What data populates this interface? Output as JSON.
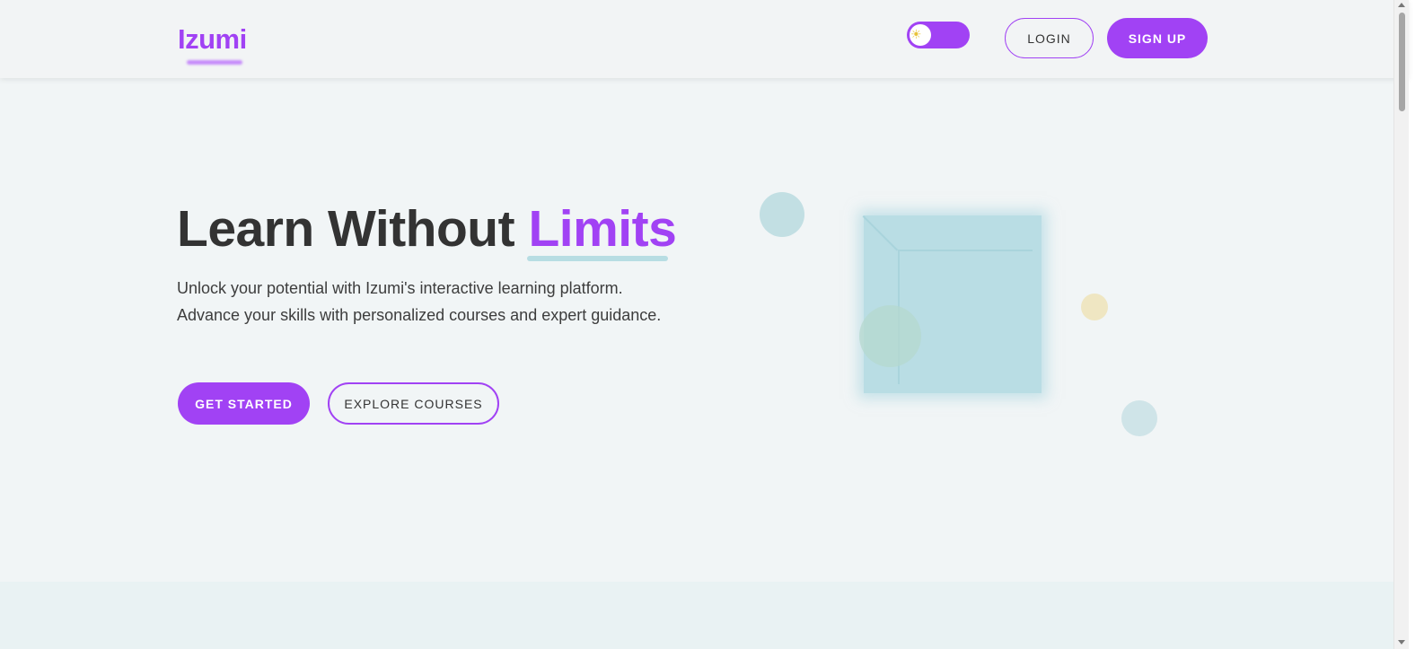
{
  "brand": {
    "name": "Izumi"
  },
  "header": {
    "theme_toggle_icon": "sun-icon",
    "login_label": "LOGIN",
    "signup_label": "SIGN UP"
  },
  "hero": {
    "title_main": "Learn Without ",
    "title_accent": "Limits",
    "description": "Unlock your potential with Izumi's interactive learning platform. Advance your skills with personalized courses and expert guidance.",
    "get_started_label": "GET STARTED",
    "explore_courses_label": "EXPLORE COURSES"
  },
  "colors": {
    "accent": "#a142f4",
    "background": "#f1f5f6",
    "cube": "#b9dde4"
  }
}
